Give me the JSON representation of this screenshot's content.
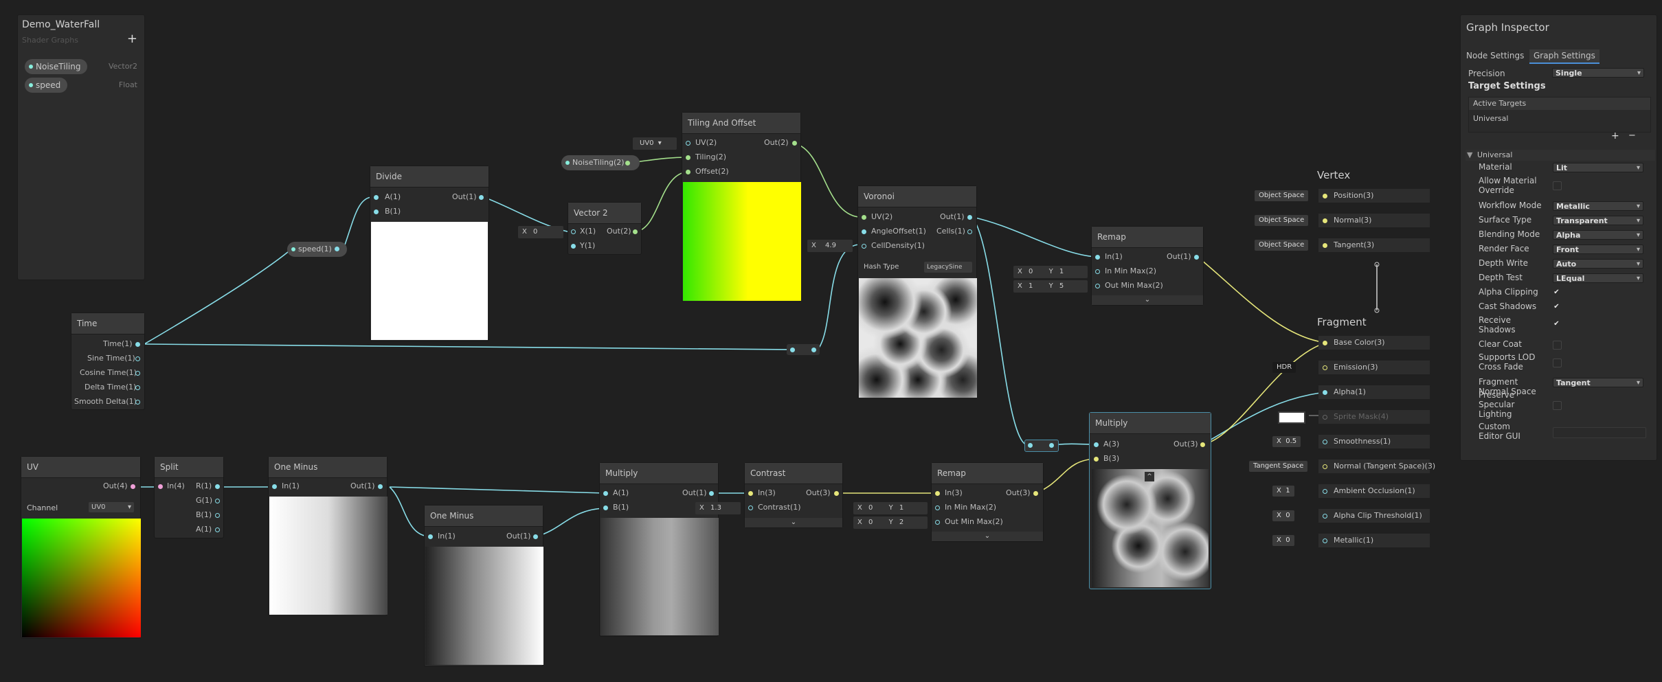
{
  "blackboard": {
    "title": "Demo_WaterFall",
    "subtitle": "Shader Graphs",
    "add_label": "+",
    "properties": [
      {
        "name": "NoiseTiling",
        "type": "Vector2"
      },
      {
        "name": "speed",
        "type": "Float"
      }
    ]
  },
  "nodes": {
    "time": {
      "title": "Time",
      "ports": [
        "Time(1)",
        "Sine Time(1)",
        "Cosine Time(1)",
        "Delta Time(1)",
        "Smooth Delta(1)"
      ]
    },
    "divide": {
      "title": "Divide",
      "a": "A(1)",
      "b": "B(1)",
      "out": "Out(1)"
    },
    "speed_chip": "speed(1)",
    "vector2": {
      "title": "Vector 2",
      "x": "X(1)",
      "y": "Y(1)",
      "out": "Out(2)",
      "x_label": "X",
      "x_val": "0"
    },
    "tiling": {
      "title": "Tiling And Offset",
      "uv": "UV(2)",
      "tiling": "Tiling(2)",
      "offset": "Offset(2)",
      "out": "Out(2)",
      "uv_select": "UV0"
    },
    "noise_chip": "NoiseTiling(2)",
    "voronoi": {
      "title": "Voronoi",
      "uv": "UV(2)",
      "angle": "AngleOffset(1)",
      "density": "CellDensity(1)",
      "out": "Out(1)",
      "cells": "Cells(1)",
      "hash_label": "Hash Type",
      "hash_value": "LegacySine",
      "x_label": "X",
      "density_val": "4.9"
    },
    "remap1": {
      "title": "Remap",
      "in": "In(1)",
      "inmin": "In Min Max(2)",
      "outmin": "Out Min Max(2)",
      "out": "Out(1)",
      "r1x": "0",
      "r1y": "1",
      "r2x": "1",
      "r2y": "5",
      "x_label": "X",
      "y_label": "Y"
    },
    "uv": {
      "title": "UV",
      "out": "Out(4)",
      "channel_label": "Channel",
      "channel_value": "UV0"
    },
    "split": {
      "title": "Split",
      "in": "In(4)",
      "r": "R(1)",
      "g": "G(1)",
      "b": "B(1)",
      "a": "A(1)"
    },
    "oneminus1": {
      "title": "One Minus",
      "in": "In(1)",
      "out": "Out(1)"
    },
    "oneminus2": {
      "title": "One Minus",
      "in": "In(1)",
      "out": "Out(1)"
    },
    "multiply1": {
      "title": "Multiply",
      "a": "A(1)",
      "b": "B(1)",
      "out": "Out(1)"
    },
    "contrast": {
      "title": "Contrast",
      "in": "In(3)",
      "c": "Contrast(1)",
      "out": "Out(3)",
      "x_label": "X",
      "c_val": "1.3"
    },
    "remap2": {
      "title": "Remap",
      "in": "In(3)",
      "inmin": "In Min Max(2)",
      "outmin": "Out Min Max(2)",
      "out": "Out(3)",
      "r1x": "0",
      "r1y": "1",
      "r2x": "0",
      "r2y": "2",
      "x_label": "X",
      "y_label": "Y"
    },
    "multiply2": {
      "title": "Multiply",
      "a": "A(3)",
      "b": "B(3)",
      "out": "Out(3)"
    },
    "vertex": {
      "title": "Vertex",
      "ports": [
        "Position(3)",
        "Normal(3)",
        "Tangent(3)"
      ],
      "space": "Object Space"
    },
    "fragment": {
      "title": "Fragment",
      "ports": [
        "Base Color(3)",
        "Emission(3)",
        "Alpha(1)",
        "Sprite Mask(4)",
        "Smoothness(1)",
        "Normal (Tangent Space)(3)",
        "Ambient Occlusion(1)",
        "Alpha Clip Threshold(1)",
        "Metallic(1)"
      ],
      "hdr": "HDR",
      "smooth_val": "0.5",
      "normal_space": "Tangent Space",
      "ao_val": "1",
      "clip_val": "0",
      "metal_val": "0",
      "x_label": "X"
    }
  },
  "inspector": {
    "title": "Graph Inspector",
    "tabs": [
      "Node Settings",
      "Graph Settings"
    ],
    "precision_label": "Precision",
    "precision_value": "Single",
    "target_settings": "Target Settings",
    "active_targets": "Active Targets",
    "target_item": "Universal",
    "add": "+",
    "remove": "−",
    "section": "Universal",
    "rows": [
      {
        "label": "Material",
        "value": "Lit"
      },
      {
        "label": "Allow Material Override",
        "value": ""
      },
      {
        "label": "Workflow Mode",
        "value": "Metallic"
      },
      {
        "label": "Surface Type",
        "value": "Transparent"
      },
      {
        "label": "Blending Mode",
        "value": "Alpha"
      },
      {
        "label": "Render Face",
        "value": "Front"
      },
      {
        "label": "Depth Write",
        "value": "Auto"
      },
      {
        "label": "Depth Test",
        "value": "LEqual"
      },
      {
        "label": "Alpha Clipping",
        "value": "checked"
      },
      {
        "label": "Cast Shadows",
        "value": "checked"
      },
      {
        "label": "Receive Shadows",
        "value": "checked"
      },
      {
        "label": "Clear Coat",
        "value": ""
      },
      {
        "label": "Supports LOD Cross Fade",
        "value": ""
      },
      {
        "label": "Fragment Normal Space",
        "value": "Tangent"
      },
      {
        "label": "Preserve Specular Lighting",
        "value": ""
      },
      {
        "label": "Custom Editor GUI",
        "value": ""
      }
    ],
    "check_glyph": "✔"
  },
  "colors": {
    "wire_float": "#88dde8",
    "wire_vec3": "#e6e67a",
    "wire_vec2": "#a4e08c"
  }
}
